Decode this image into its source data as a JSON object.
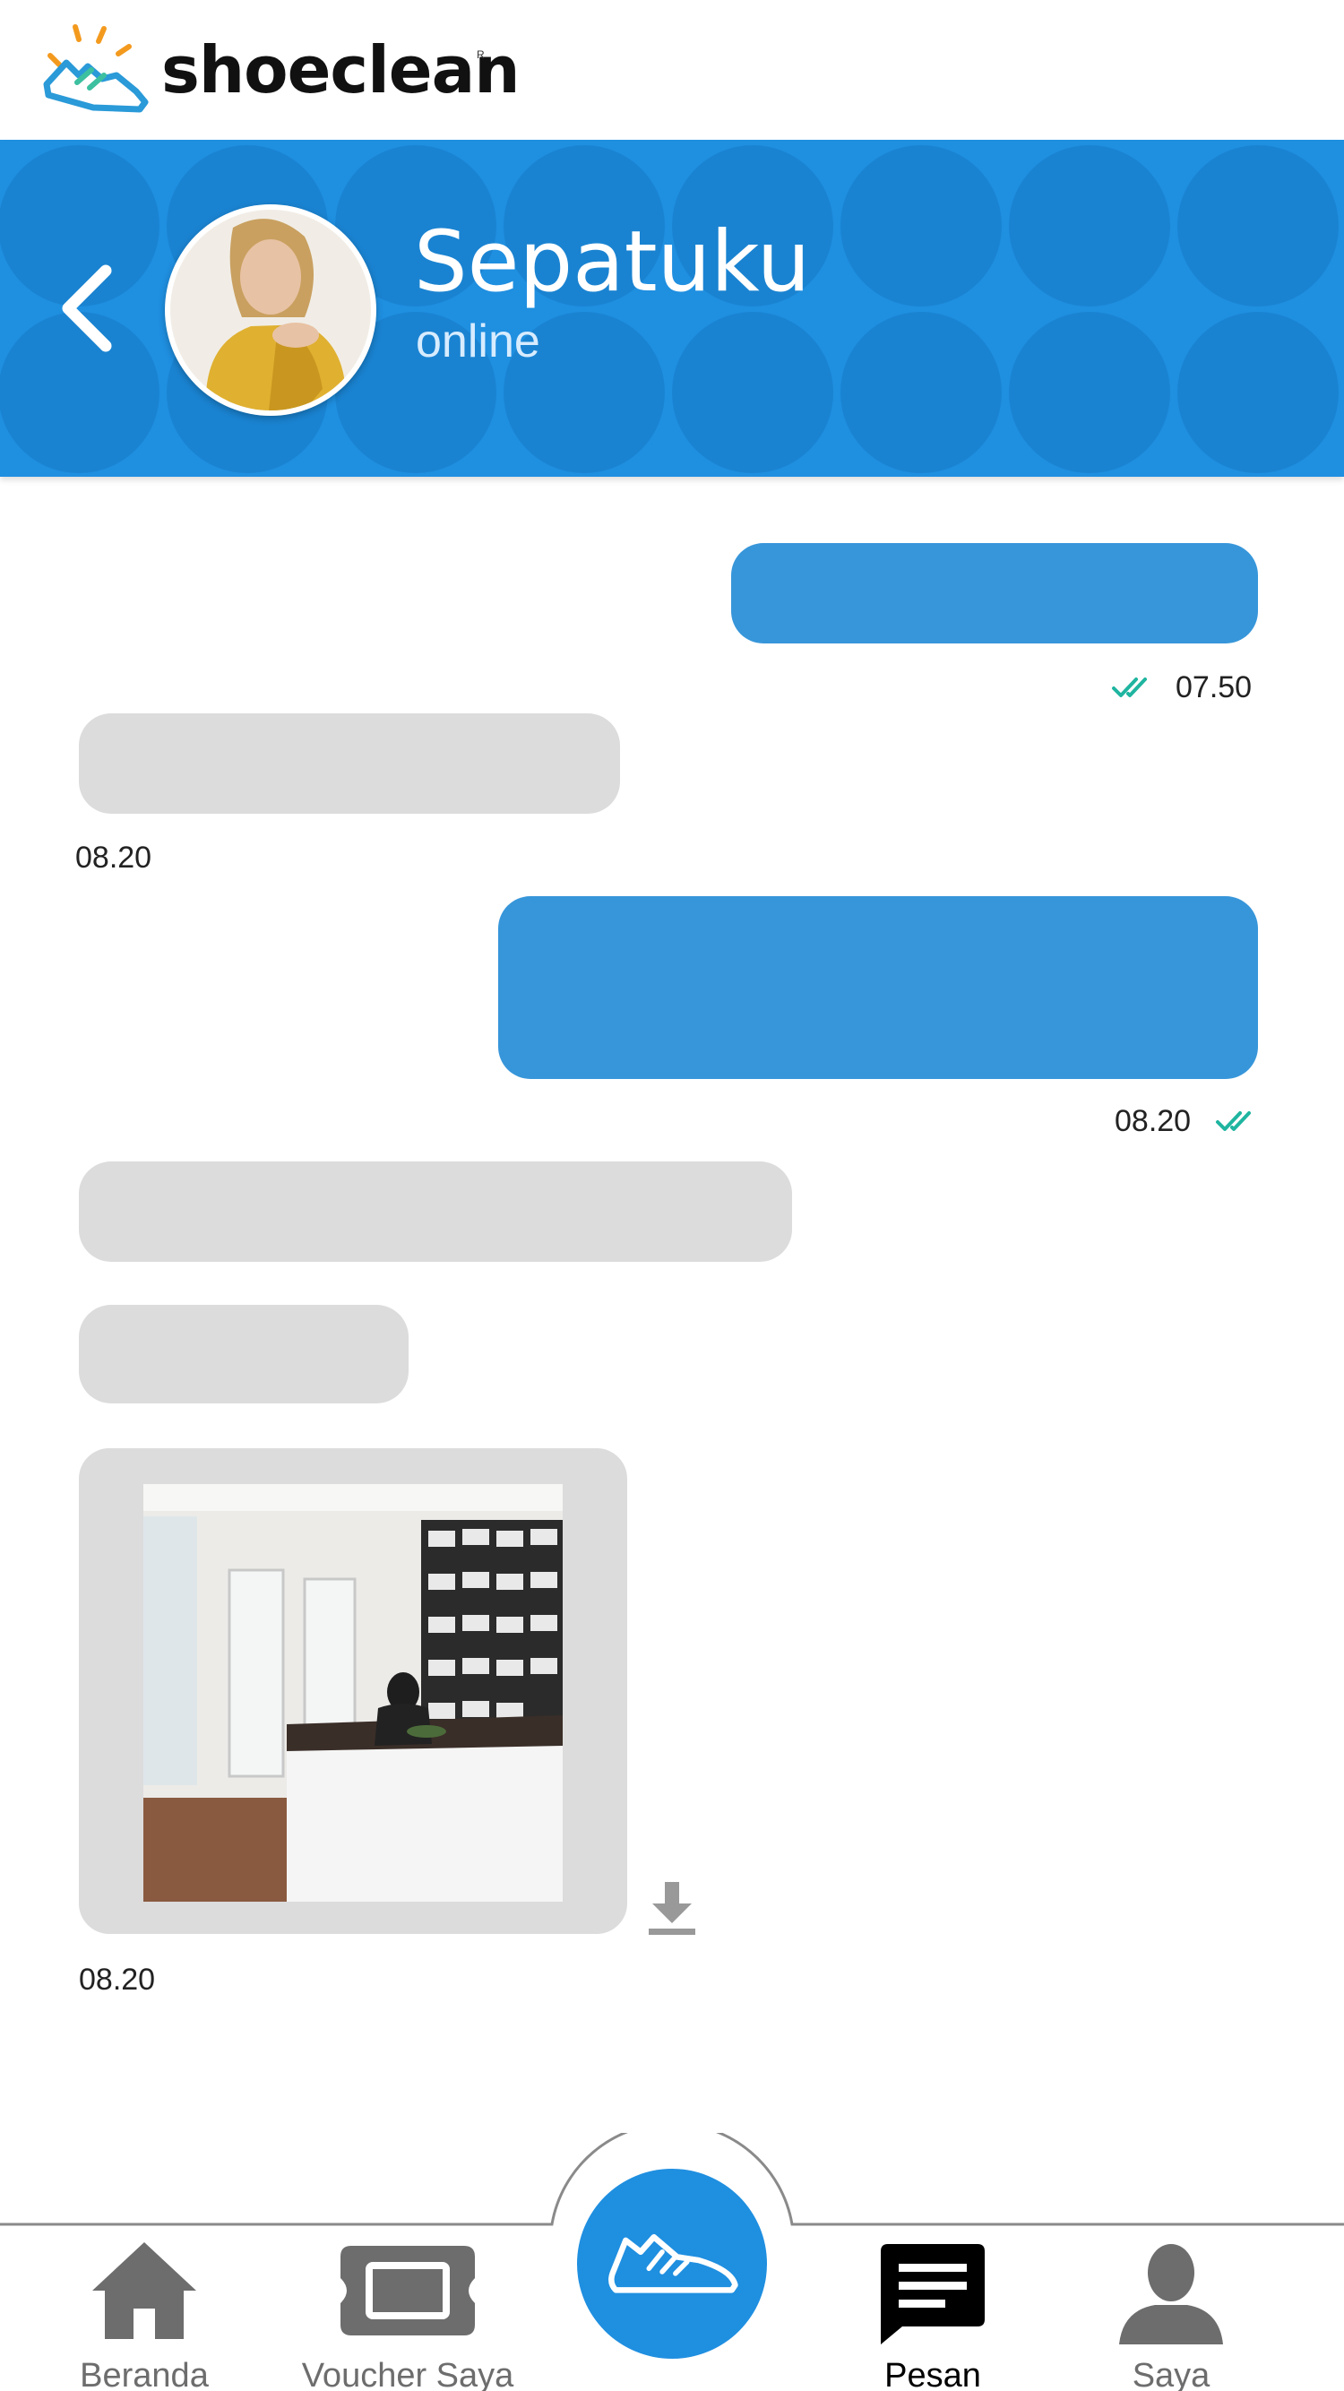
{
  "app": {
    "logo_text": "shoeclean",
    "logo_mark": "R"
  },
  "header": {
    "name": "Sepatuku",
    "status": "online"
  },
  "messages": [
    {
      "time": "07.50"
    },
    {
      "time": "08.20"
    },
    {
      "time": "08.20"
    },
    {
      "time": "08.20"
    }
  ],
  "nav": {
    "items": [
      {
        "label": "Beranda",
        "icon": "home-icon"
      },
      {
        "label": "Voucher Saya",
        "icon": "ticket-icon"
      },
      {
        "label": "Pesan",
        "icon": "chat-icon"
      },
      {
        "label": "Saya",
        "icon": "person-icon"
      }
    ]
  },
  "colors": {
    "brand_blue": "#1f8fe0",
    "outgoing_bubble": "#3796da",
    "incoming_bubble": "#dcdcdc",
    "tick_color": "#1fb5a0"
  }
}
